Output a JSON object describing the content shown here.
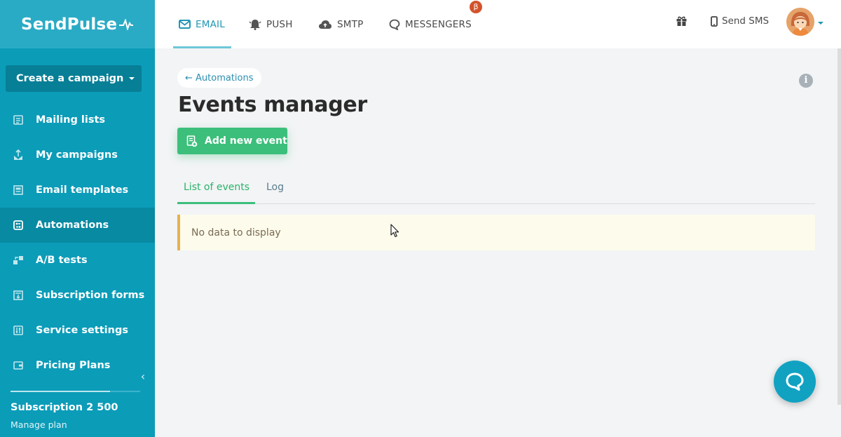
{
  "brand": {
    "name": "SendPulse"
  },
  "sidebar": {
    "create_button": "Create a campaign",
    "items": [
      {
        "label": "Mailing lists",
        "icon": "mailing-lists-icon"
      },
      {
        "label": "My campaigns",
        "icon": "campaigns-icon"
      },
      {
        "label": "Email templates",
        "icon": "templates-icon"
      },
      {
        "label": "Automations",
        "icon": "automations-icon",
        "active": true
      },
      {
        "label": "A/B tests",
        "icon": "ab-tests-icon"
      },
      {
        "label": "Subscription forms",
        "icon": "forms-icon"
      },
      {
        "label": "Service settings",
        "icon": "settings-icon"
      },
      {
        "label": "Pricing Plans",
        "icon": "pricing-icon"
      }
    ],
    "subscription": {
      "title": "Subscription 2 500",
      "link": "Manage plan",
      "usage_fraction": 0.77
    }
  },
  "topbar": {
    "tabs": [
      {
        "label": "EMAIL",
        "icon": "envelope-icon",
        "active": true
      },
      {
        "label": "PUSH",
        "icon": "bell-icon"
      },
      {
        "label": "SMTP",
        "icon": "cloud-upload-icon"
      },
      {
        "label": "MESSENGERS",
        "icon": "chat-bubble-icon",
        "badge": "β"
      }
    ],
    "send_sms": "Send SMS"
  },
  "main": {
    "back_link": "← Automations",
    "title": "Events manager",
    "add_button": "Add new event",
    "tabs": [
      {
        "label": "List of events",
        "active": true
      },
      {
        "label": "Log"
      }
    ],
    "empty_message": "No data to display"
  },
  "colors": {
    "sidebar": "#0b9cb8",
    "accent_green": "#3cbf7b",
    "accent_blue": "#2097b5",
    "warning_border": "#e8b04e"
  }
}
